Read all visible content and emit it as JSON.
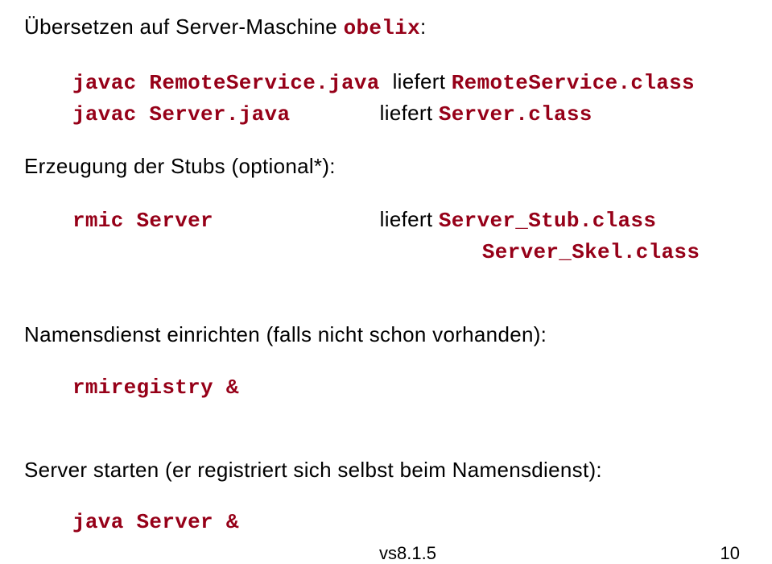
{
  "title_prefix": "Übersetzen auf Server-Maschine ",
  "title_machine": "obelix",
  "title_suffix": ":",
  "cmd1_a": "javac ",
  "cmd1_b": "RemoteService.java ",
  "cmd1_liefert": "liefert ",
  "cmd1_c": "RemoteService.class",
  "cmd2_a": "javac ",
  "cmd2_b": "Server.java       ",
  "cmd2_liefert": "liefert ",
  "cmd2_c": "Server.class",
  "stub_heading": "Erzeugung der Stubs (optional*):",
  "cmd3_a": "rmic Server             ",
  "cmd3_liefert": "liefert ",
  "cmd3_b": "Server_Stub.class",
  "cmd3_c": "Server_Skel.class",
  "cmd3_pad": "                                ",
  "nameservice_heading": "Namensdienst einrichten (falls nicht schon vorhanden):",
  "cmd4": "rmiregistry &",
  "serverstart_heading": "Server starten (er registriert sich selbst beim Namensdienst):",
  "cmd5": "java Server &",
  "footer_center": "vs8.1.5",
  "footer_right": "10"
}
